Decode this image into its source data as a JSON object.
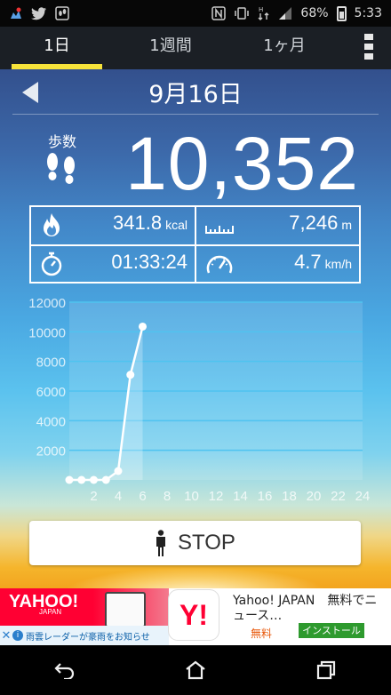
{
  "status_bar": {
    "battery": "68%",
    "time": "5:33",
    "left_icons": [
      "app-notification-icon",
      "twitter-icon",
      "step-app-icon"
    ],
    "right_icons": [
      "nfc-icon",
      "vibrate-icon",
      "data-transfer-icon",
      "signal-icon"
    ]
  },
  "tabs": [
    {
      "label": "1日",
      "active": true
    },
    {
      "label": "1週間",
      "active": false
    },
    {
      "label": "1ヶ月",
      "active": false
    }
  ],
  "date": "9月16日",
  "steps": {
    "label": "歩数",
    "value": "10,352"
  },
  "stats": {
    "calories": {
      "value": "341.8",
      "unit": "kcal"
    },
    "distance": {
      "value": "7,246",
      "unit": "m"
    },
    "duration": {
      "value": "01:33:24"
    },
    "speed": {
      "value": "4.7",
      "unit": "km/h"
    }
  },
  "chart_data": {
    "type": "area",
    "x": [
      0,
      1,
      2,
      3,
      4,
      5,
      6
    ],
    "values": [
      0,
      0,
      0,
      0,
      600,
      7100,
      10352
    ],
    "x_ticks": [
      "2",
      "4",
      "6",
      "8",
      "10",
      "12",
      "14",
      "16",
      "18",
      "20",
      "22",
      "24"
    ],
    "y_ticks": [
      "2000",
      "4000",
      "6000",
      "8000",
      "10000",
      "12000"
    ],
    "xlim": [
      0,
      24
    ],
    "ylim": [
      0,
      12000
    ],
    "grid": true
  },
  "stop_button": {
    "label": "STOP"
  },
  "ad": {
    "brand": "YAHOO!",
    "brand_sub": "JAPAN",
    "strip_text": "雨雲レーダーが豪雨をお知らせ",
    "logo": "Y!",
    "title": "Yahoo! JAPAN　無料でニュース…",
    "free_label": "無料",
    "install_label": "インストール"
  },
  "nav": [
    "back-icon",
    "home-icon",
    "recents-icon"
  ]
}
